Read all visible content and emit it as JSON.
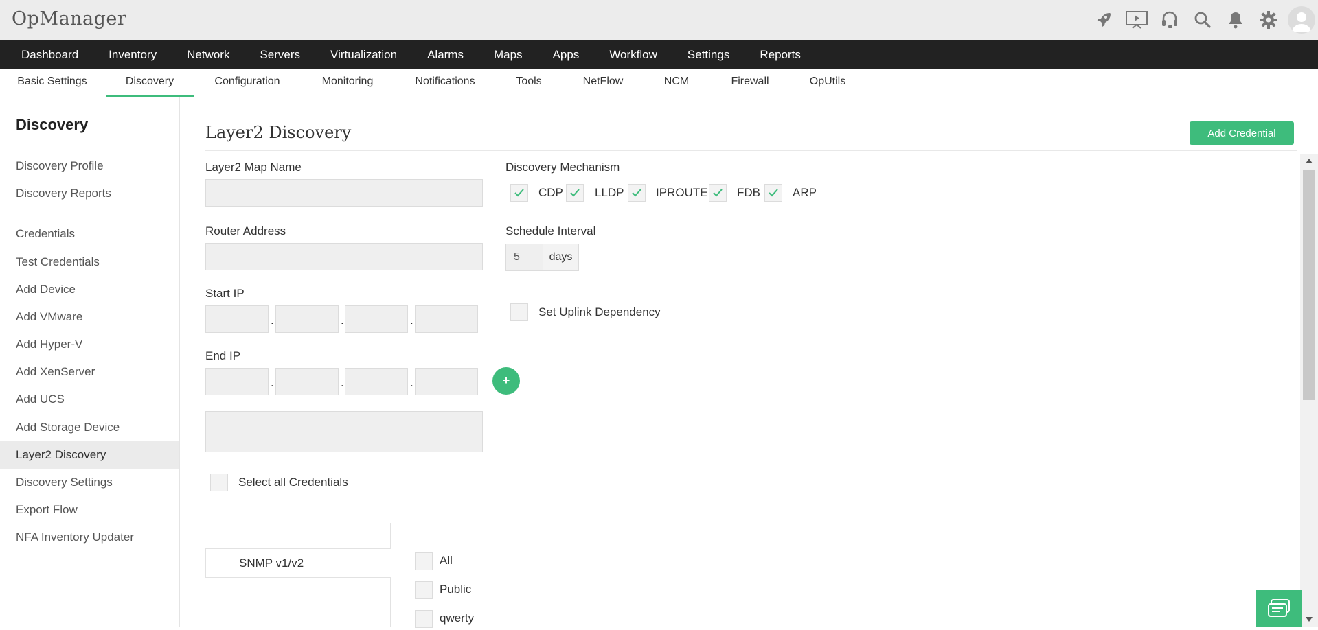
{
  "app": {
    "brand": "OpManager"
  },
  "top_icons": [
    "rocket-icon",
    "presentation-icon",
    "headset-icon",
    "search-icon",
    "bell-icon",
    "gear-icon"
  ],
  "nav": {
    "items": [
      "Dashboard",
      "Inventory",
      "Network",
      "Servers",
      "Virtualization",
      "Alarms",
      "Maps",
      "Apps",
      "Workflow",
      "Settings",
      "Reports"
    ]
  },
  "subnav": {
    "items": [
      "Basic Settings",
      "Discovery",
      "Configuration",
      "Monitoring",
      "Notifications",
      "Tools",
      "NetFlow",
      "NCM",
      "Firewall",
      "OpUtils"
    ],
    "active": "Discovery"
  },
  "sidebar": {
    "title": "Discovery",
    "items": [
      "Discovery Profile",
      "Discovery Reports",
      "Credentials",
      "Test Credentials",
      "Add Device",
      "Add VMware",
      "Add Hyper-V",
      "Add XenServer",
      "Add UCS",
      "Add Storage Device",
      "Layer2 Discovery",
      "Discovery Settings",
      "Export Flow",
      "NFA Inventory Updater"
    ],
    "active": "Layer2 Discovery"
  },
  "page": {
    "title": "Layer2 Discovery",
    "add_credential_label": "Add Credential"
  },
  "form": {
    "map_name_label": "Layer2 Map Name",
    "map_name_value": "",
    "router_address_label": "Router Address",
    "router_address_value": "",
    "start_ip_label": "Start IP",
    "end_ip_label": "End IP",
    "ip_separator": ".",
    "add_range_label": "+",
    "discovery_mechanism_label": "Discovery Mechanism",
    "mechanisms": [
      {
        "label": "CDP",
        "checked": true
      },
      {
        "label": "LLDP",
        "checked": true
      },
      {
        "label": "IPROUTE",
        "checked": true
      },
      {
        "label": "FDB",
        "checked": true
      },
      {
        "label": "ARP",
        "checked": true
      }
    ],
    "schedule_interval_label": "Schedule Interval",
    "schedule_interval_value": "5",
    "schedule_interval_unit": "days",
    "uplink_dependency_label": "Set Uplink Dependency",
    "uplink_dependency_checked": false,
    "select_all_credentials_label": "Select all Credentials",
    "credential_type": "SNMP v1/v2",
    "credentials": [
      {
        "label": "All",
        "checked": false
      },
      {
        "label": "Public",
        "checked": false
      },
      {
        "label": "qwerty",
        "checked": false
      }
    ]
  },
  "colors": {
    "accent": "#3ebc7c",
    "nav_bg": "#222222",
    "topbar_bg": "#ececec"
  }
}
